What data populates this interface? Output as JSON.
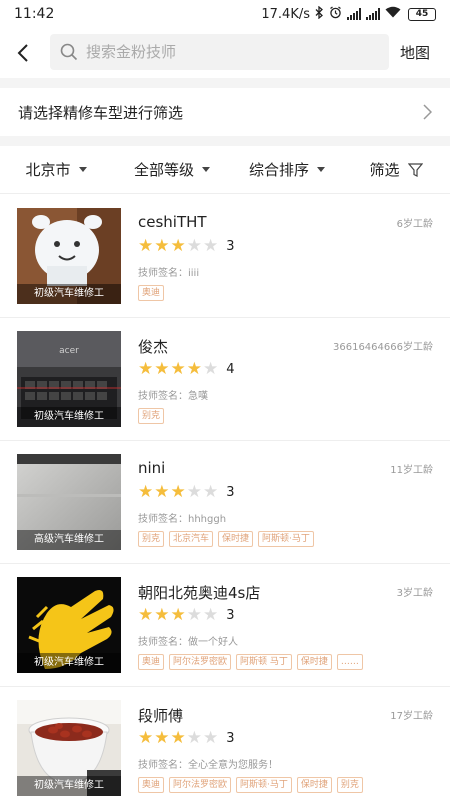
{
  "status_bar": {
    "time": "11:42",
    "speed": "17.4K/s",
    "battery": "45"
  },
  "header": {
    "search_placeholder": "搜索金粉技师",
    "map_label": "地图"
  },
  "filter": {
    "label": "请选择精修车型进行筛选"
  },
  "sort_bar": {
    "city": "北京市",
    "level": "全部等级",
    "sort": "综合排序",
    "filter_label": "筛选"
  },
  "colors": {
    "star_on": "#f5bd3c",
    "star_off": "#dcdcdc",
    "tag": "#e0a37a"
  },
  "technicians": [
    {
      "name": "ceshiTHT",
      "experience": "6岁工龄",
      "stars": 3,
      "rating": "3",
      "signature": "技师签名：iiii",
      "badge": "初级汽车维修工",
      "tags": [
        "奥迪"
      ],
      "image": "cartoon-mascot"
    },
    {
      "name": "俊杰",
      "experience": "36616464666岁工龄",
      "stars": 4,
      "rating": "4",
      "signature": "技师签名：急嘆",
      "badge": "初级汽车维修工",
      "tags": [
        "别克"
      ],
      "image": "laptop-keyboard"
    },
    {
      "name": "nini",
      "experience": "11岁工龄",
      "stars": 3,
      "rating": "3",
      "signature": "技师签名：hhhggh",
      "badge": "高级汽车维修工",
      "tags": [
        "别克",
        "北京汽车",
        "保时捷",
        "阿斯顿·马丁"
      ],
      "image": "gray-surface"
    },
    {
      "name": "朝阳北苑奥迪4s店",
      "experience": "3岁工龄",
      "stars": 3,
      "rating": "3",
      "signature": "技师签名：做一个好人",
      "badge": "初级汽车维修工",
      "tags": [
        "奥迪",
        "阿尔法罗密欧",
        "阿斯顿 马丁",
        "保时捷",
        "……"
      ],
      "image": "clapping-hands"
    },
    {
      "name": "段师傅",
      "experience": "17岁工龄",
      "stars": 3,
      "rating": "3",
      "signature": "技师签名：全心全意为您服务！",
      "badge": "初级汽车维修工",
      "tags": [
        "奥迪",
        "阿尔法罗密欧",
        "阿斯顿·马丁",
        "保时捷",
        "别克"
      ],
      "image": "bean-bowl"
    }
  ]
}
